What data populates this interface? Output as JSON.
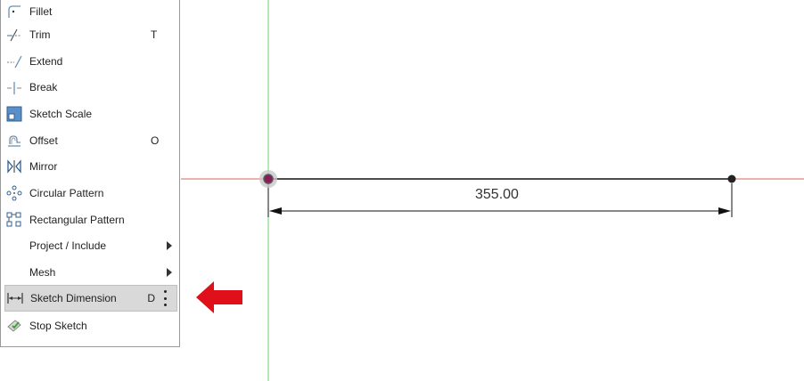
{
  "menu": {
    "items": [
      {
        "label": "Fillet",
        "shortcut": "",
        "icon": "fillet-icon"
      },
      {
        "label": "Trim",
        "shortcut": "T",
        "icon": "trim-icon"
      },
      {
        "label": "Extend",
        "shortcut": "",
        "icon": "extend-icon"
      },
      {
        "label": "Break",
        "shortcut": "",
        "icon": "break-icon"
      },
      {
        "label": "Sketch Scale",
        "shortcut": "",
        "icon": "sketch-scale-icon"
      },
      {
        "label": "Offset",
        "shortcut": "O",
        "icon": "offset-icon"
      },
      {
        "label": "Mirror",
        "shortcut": "",
        "icon": "mirror-icon"
      },
      {
        "label": "Circular Pattern",
        "shortcut": "",
        "icon": "circular-pattern-icon"
      },
      {
        "label": "Rectangular Pattern",
        "shortcut": "",
        "icon": "rectangular-pattern-icon"
      },
      {
        "label": "Project / Include",
        "shortcut": "",
        "icon": ""
      },
      {
        "label": "Mesh",
        "shortcut": "",
        "icon": ""
      },
      {
        "label": "Sketch Dimension",
        "shortcut": "D",
        "icon": "sketch-dimension-icon"
      },
      {
        "label": "Stop Sketch",
        "shortcut": "",
        "icon": "stop-sketch-icon"
      }
    ]
  },
  "dimension": {
    "value": "355.00"
  },
  "colors": {
    "x_axis": "#e06060",
    "y_axis": "#6ad06a",
    "highlight": "#d9d9d9",
    "arrow": "#e0101a",
    "origin_point": "#8e1a5a"
  }
}
